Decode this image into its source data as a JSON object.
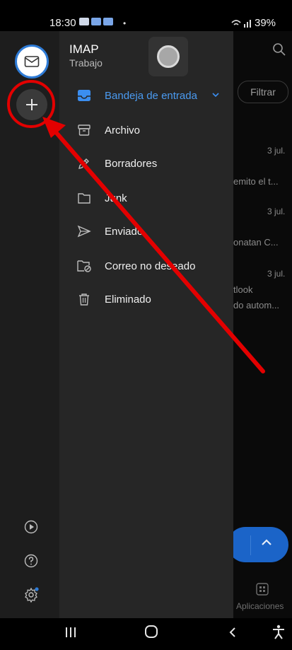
{
  "status_bar": {
    "time": "18:30",
    "dot": "•",
    "battery": "39%"
  },
  "account": {
    "name": "IMAP",
    "type": "Trabajo"
  },
  "folders": [
    {
      "label": "Bandeja de entrada",
      "icon": "inbox-icon",
      "selected": true
    },
    {
      "label": "Archivo",
      "icon": "archive-icon"
    },
    {
      "label": "Borradores",
      "icon": "draft-pencil-icon"
    },
    {
      "label": "Junk",
      "icon": "folder-icon"
    },
    {
      "label": "Enviado",
      "icon": "send-icon"
    },
    {
      "label": "Correo no deseado",
      "icon": "spam-folder-icon"
    },
    {
      "label": "Eliminado",
      "icon": "trash-icon"
    }
  ],
  "background": {
    "filter_label": "Filtrar",
    "dates": [
      "3 jul.",
      "3 jul.",
      "3 jul."
    ],
    "snippets": [
      "emito el t...",
      "onatan C...",
      "tlook",
      "do autom..."
    ],
    "apps_label": "Aplicaciones",
    "fab_chevron": "^"
  },
  "colors": {
    "accent": "#2e7bd6",
    "annotation": "#e30000",
    "drawer": "#262626",
    "rail": "#1d1d1d"
  }
}
